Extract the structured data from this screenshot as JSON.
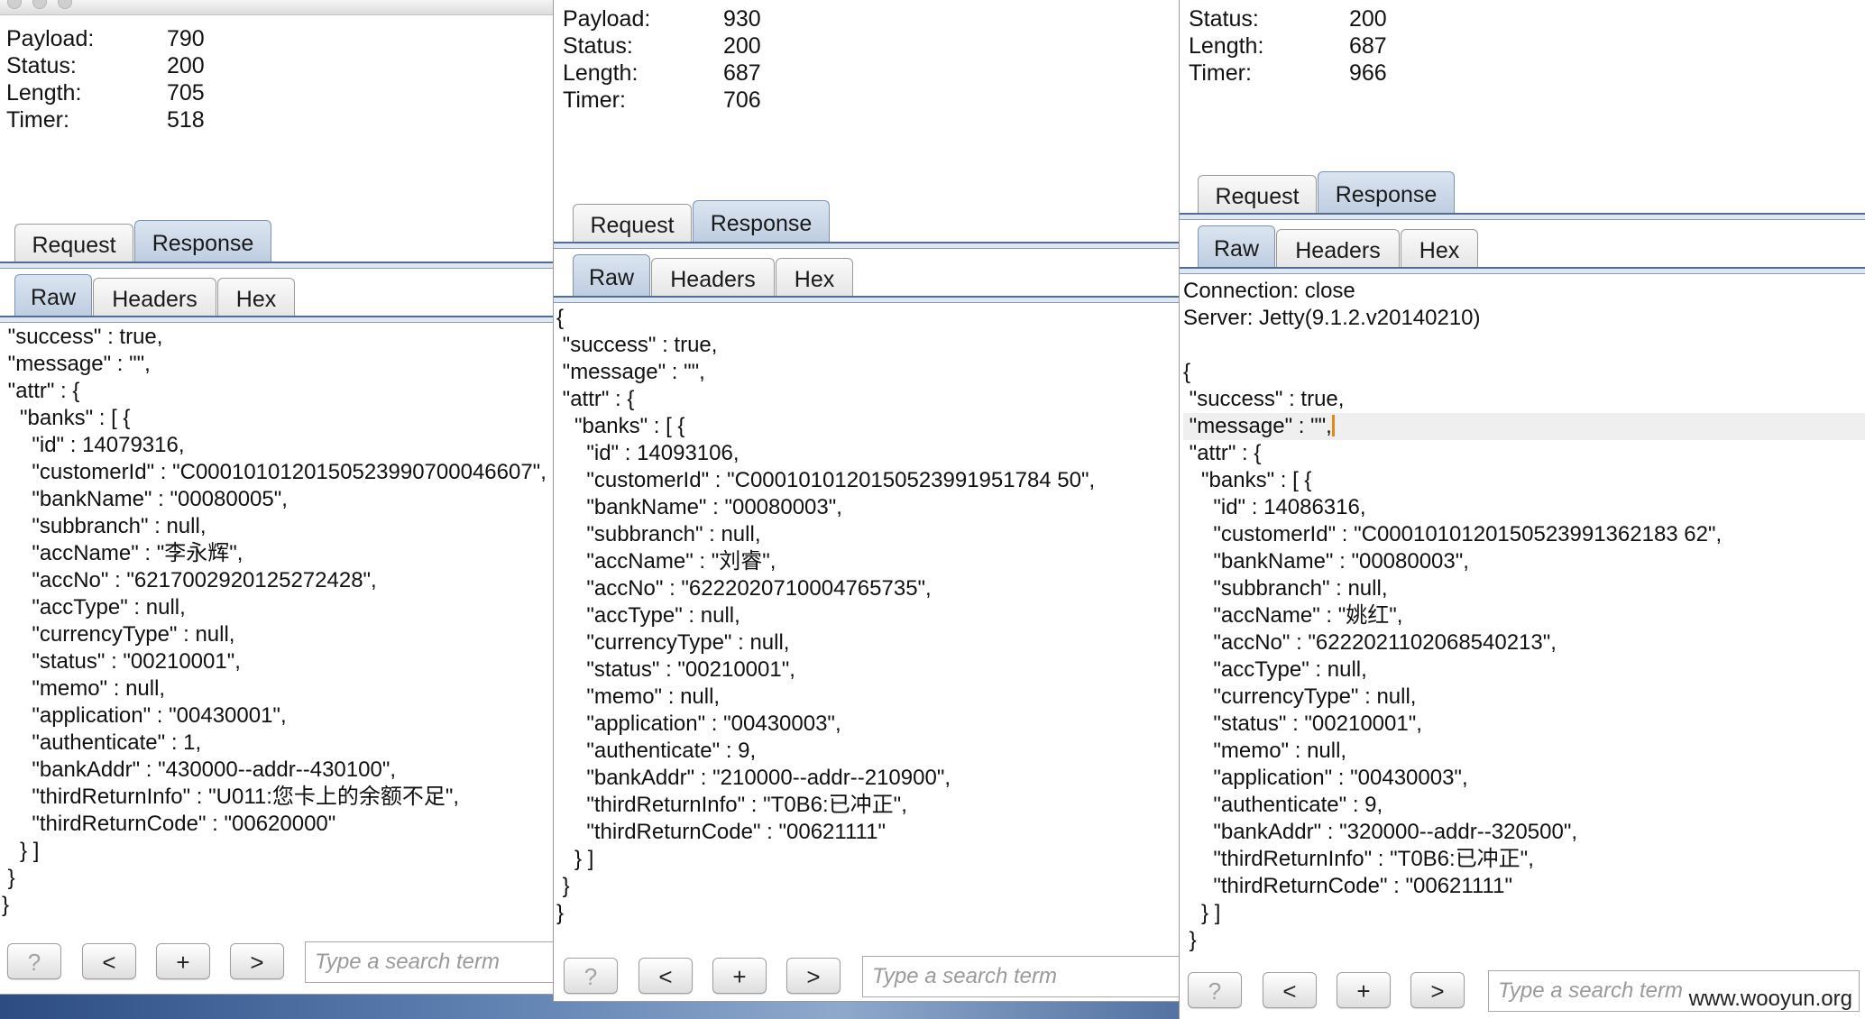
{
  "colors": {
    "tab_active": "#c8d6e8",
    "caret": "#e08a17",
    "desktop": "#3a5a8c"
  },
  "icons": {
    "help": "question-mark-icon",
    "prev": "chevron-left-icon",
    "add": "plus-icon",
    "next": "chevron-right-icon"
  },
  "panels": [
    {
      "meta": [
        {
          "key": "Payload:",
          "value": "790"
        },
        {
          "key": "Status:",
          "value": "200"
        },
        {
          "key": "Length:",
          "value": "705"
        },
        {
          "key": "Timer:",
          "value": "518"
        }
      ],
      "main_tabs": [
        "Request",
        "Response"
      ],
      "main_active": "Response",
      "sub_tabs": [
        "Raw",
        "Headers",
        "Hex"
      ],
      "sub_active": "Raw",
      "body_lines": [
        " \"success\" : true,",
        " \"message\" : \"\",",
        " \"attr\" : {",
        "   \"banks\" : [ {",
        "     \"id\" : 14079316,",
        "     \"customerId\" : \"C0001010120150523990700046607\",",
        "     \"bankName\" : \"00080005\",",
        "     \"subbranch\" : null,",
        "     \"accName\" : \"李永辉\",",
        "     \"accNo\" : \"6217002920125272428\",",
        "     \"accType\" : null,",
        "     \"currencyType\" : null,",
        "     \"status\" : \"00210001\",",
        "     \"memo\" : null,",
        "     \"application\" : \"00430001\",",
        "     \"authenticate\" : 1,",
        "     \"bankAddr\" : \"430000--addr--430100\",",
        "     \"thirdReturnInfo\" : \"U011:您卡上的余额不足\",",
        "     \"thirdReturnCode\" : \"00620000\"",
        "   } ]",
        " }",
        "}"
      ],
      "buttons": [
        "?",
        "<",
        "+",
        ">"
      ],
      "search_placeholder": "Type a search term"
    },
    {
      "meta": [
        {
          "key": "Payload:",
          "value": "930"
        },
        {
          "key": "Status:",
          "value": "200"
        },
        {
          "key": "Length:",
          "value": "687"
        },
        {
          "key": "Timer:",
          "value": "706"
        }
      ],
      "main_tabs": [
        "Request",
        "Response"
      ],
      "main_active": "Response",
      "sub_tabs": [
        "Raw",
        "Headers",
        "Hex"
      ],
      "sub_active": "Raw",
      "body_lines": [
        "{",
        " \"success\" : true,",
        " \"message\" : \"\",",
        " \"attr\" : {",
        "   \"banks\" : [ {",
        "     \"id\" : 14093106,",
        "     \"customerId\" : \"C0001010120150523991951784 50\",",
        "     \"bankName\" : \"00080003\",",
        "     \"subbranch\" : null,",
        "     \"accName\" : \"刘睿\",",
        "     \"accNo\" : \"6222020710004765735\",",
        "     \"accType\" : null,",
        "     \"currencyType\" : null,",
        "     \"status\" : \"00210001\",",
        "     \"memo\" : null,",
        "     \"application\" : \"00430003\",",
        "     \"authenticate\" : 9,",
        "     \"bankAddr\" : \"210000--addr--210900\",",
        "     \"thirdReturnInfo\" : \"T0B6:已冲正\",",
        "     \"thirdReturnCode\" : \"00621111\"",
        "   } ]",
        " }",
        "}"
      ],
      "buttons": [
        "?",
        "<",
        "+",
        ">"
      ],
      "search_placeholder": "Type a search term"
    },
    {
      "meta": [
        {
          "key": "Status:",
          "value": "200"
        },
        {
          "key": "Length:",
          "value": "687"
        },
        {
          "key": "Timer:",
          "value": "966"
        }
      ],
      "main_tabs": [
        "Request",
        "Response"
      ],
      "main_active": "Response",
      "sub_tabs": [
        "Raw",
        "Headers",
        "Hex"
      ],
      "sub_active": "Raw",
      "body_lines": [
        "Connection: close",
        "Server: Jetty(9.1.2.v20140210)",
        "",
        "{",
        " \"success\" : true,",
        " \"message\" : \"\",",
        " \"attr\" : {",
        "   \"banks\" : [ {",
        "     \"id\" : 14086316,",
        "     \"customerId\" : \"C0001010120150523991362183 62\",",
        "     \"bankName\" : \"00080003\",",
        "     \"subbranch\" : null,",
        "     \"accName\" : \"姚红\",",
        "     \"accNo\" : \"6222021102068540213\",",
        "     \"accType\" : null,",
        "     \"currencyType\" : null,",
        "     \"status\" : \"00210001\",",
        "     \"memo\" : null,",
        "     \"application\" : \"00430003\",",
        "     \"authenticate\" : 9,",
        "     \"bankAddr\" : \"320000--addr--320500\",",
        "     \"thirdReturnInfo\" : \"T0B6:已冲正\",",
        "     \"thirdReturnCode\" : \"00621111\"",
        "   } ]",
        " }",
        "}"
      ],
      "cursor_line": 5,
      "buttons": [
        "?",
        "<",
        "+",
        ">"
      ],
      "search_placeholder": "Type a search term",
      "watermark": "www.wooyun.org"
    }
  ]
}
